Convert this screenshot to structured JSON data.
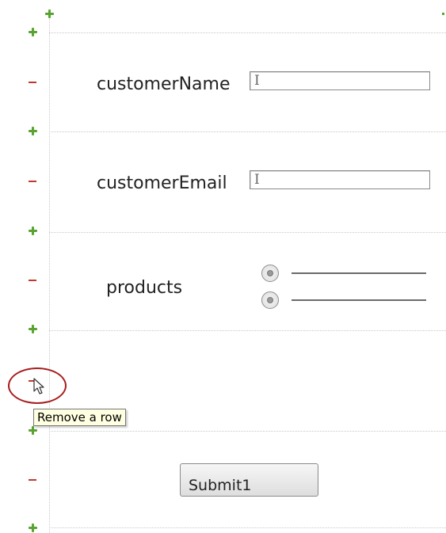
{
  "form": {
    "fields": [
      {
        "label": "customerName",
        "type": "text",
        "value": "",
        "caret": "I"
      },
      {
        "label": "customerEmail",
        "type": "text",
        "value": "",
        "caret": "I"
      },
      {
        "label": "products",
        "type": "radio-group",
        "options": [
          "",
          ""
        ]
      }
    ],
    "submit_label": "Submit1"
  },
  "tooltip": {
    "text": "Remove a row"
  },
  "icons": {
    "add_row": "plus-icon",
    "remove_row": "minus-icon",
    "pointer": "mouse-pointer-icon"
  },
  "colors": {
    "add_green": "#5aa332",
    "remove_red": "#c0392b",
    "highlight": "#a61d1d",
    "tooltip_bg": "#ffffe1"
  }
}
